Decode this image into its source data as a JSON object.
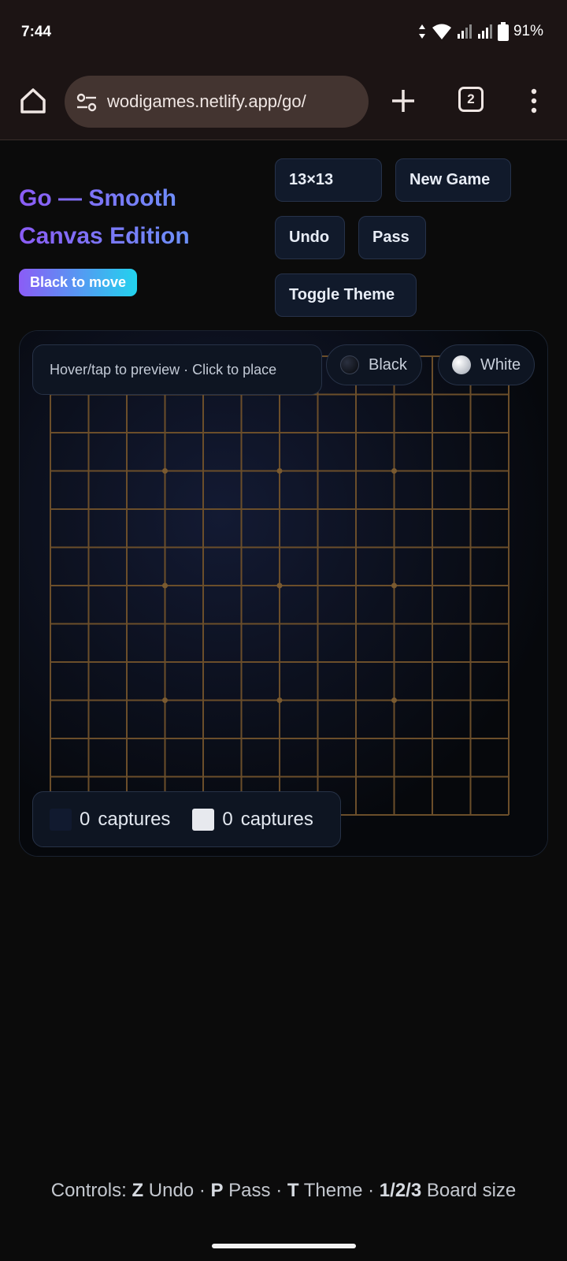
{
  "status": {
    "time": "7:44",
    "battery": "91%"
  },
  "browser": {
    "url": "wodigames.netlify.app/go/",
    "tab_count": "2"
  },
  "page": {
    "title": "Go — Smooth Canvas Edition",
    "turn_badge": "Black to move",
    "buttons": {
      "size": "13×13",
      "new_game": "New Game",
      "undo": "Undo",
      "pass": "Pass",
      "toggle_theme": "Toggle Theme"
    },
    "hint": "Hover/tap to preview · Click to place",
    "players": {
      "black": "Black",
      "white": "White"
    },
    "captures": {
      "black_count": "0",
      "white_count": "0",
      "label": "captures"
    },
    "footer": {
      "prefix": "Controls: ",
      "undo_key": "Z",
      "undo_text": " Undo · ",
      "pass_key": "P",
      "pass_text": " Pass · ",
      "theme_key": "T",
      "theme_text": " Theme · ",
      "size_keys": "1/2/3",
      "size_text": " Board size"
    }
  },
  "board": {
    "size": 13,
    "stones": [],
    "line_color": "#6b4e2a",
    "star_color": "#7a5a30"
  },
  "colors": {
    "accent_start": "#8b5cf6",
    "accent_end": "#22d3ee",
    "button_bg": "#111a2b"
  }
}
